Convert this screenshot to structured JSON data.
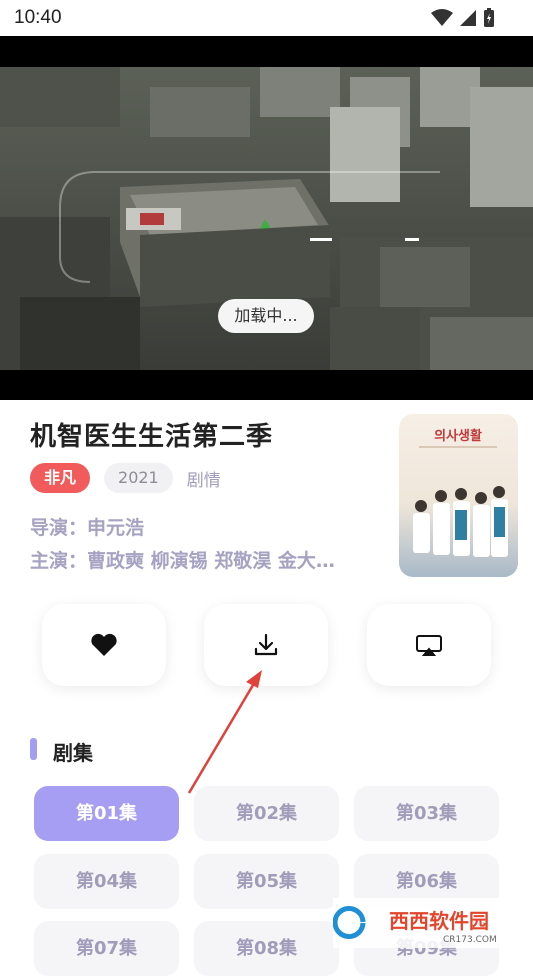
{
  "status": {
    "time": "10:40"
  },
  "player": {
    "loading": "加载中..."
  },
  "show": {
    "title": "机智医生生活第二季",
    "source": "非凡",
    "year": "2021",
    "genre": "剧情",
    "director": "导演：申元浩",
    "cast": "主演：曹政奭 柳演锡 郑敬淏 金大…",
    "poster_text": "의사생활"
  },
  "episodes": {
    "title": "剧集",
    "items": [
      "第01集",
      "第02集",
      "第03集",
      "第04集",
      "第05集",
      "第06集",
      "第07集",
      "第08集",
      "第09集"
    ],
    "selected": "第01集"
  },
  "watermark": {
    "brand": "西西软件园",
    "domain": "CR173.COM"
  },
  "colors": {
    "accent": "#a59ef2",
    "badge_red": "#f15b5b"
  }
}
